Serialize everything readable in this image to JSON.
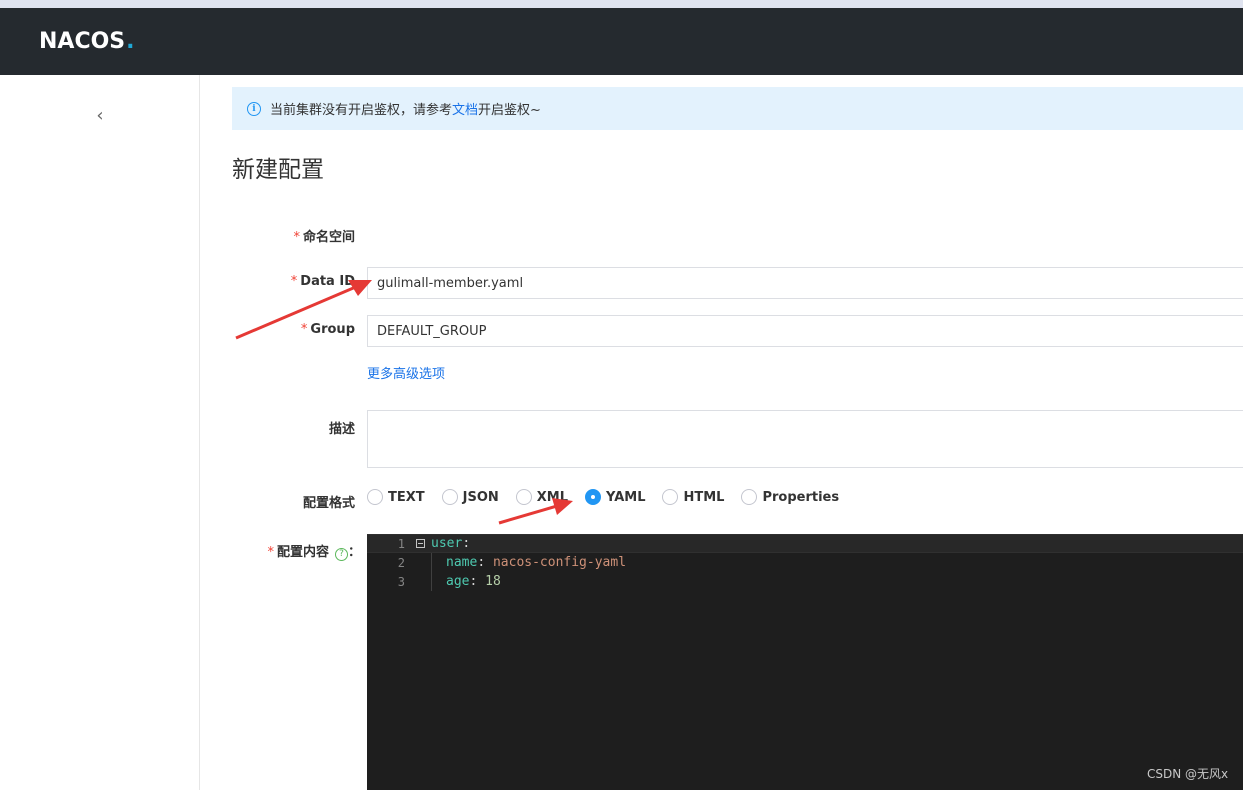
{
  "app": {
    "logo_text": "NACOS",
    "logo_dot": "."
  },
  "sidebar": {
    "collapse_glyph": "‹"
  },
  "notice": {
    "text_before": "当前集群没有开启鉴权，请参考",
    "link": "文档",
    "text_after": "开启鉴权~"
  },
  "page": {
    "title": "新建配置"
  },
  "form": {
    "namespace_label": "命名空间",
    "dataid_label": "Data ID",
    "dataid_value": "gulimall-member.yaml",
    "group_label": "Group",
    "group_value": "DEFAULT_GROUP",
    "advanced_link": "更多高级选项",
    "desc_label": "描述",
    "desc_value": "",
    "format_label": "配置格式",
    "formats": [
      "TEXT",
      "JSON",
      "XML",
      "YAML",
      "HTML",
      "Properties"
    ],
    "selected_format": "YAML",
    "content_label": "配置内容",
    "content_help_glyph": "?",
    "content_colon": "："
  },
  "editor": {
    "lines": [
      {
        "num": "1",
        "key": "user",
        "sep": ":",
        "value": ""
      },
      {
        "num": "2",
        "key": "name",
        "sep": ": ",
        "value": "nacos-config-yaml"
      },
      {
        "num": "3",
        "key": "age",
        "sep": ": ",
        "value": "18"
      }
    ]
  },
  "watermark": "CSDN @无风x",
  "colors": {
    "accent": "#2196f3",
    "required": "#f04134",
    "topbar": "#252a2f",
    "arrow": "#e53935"
  }
}
